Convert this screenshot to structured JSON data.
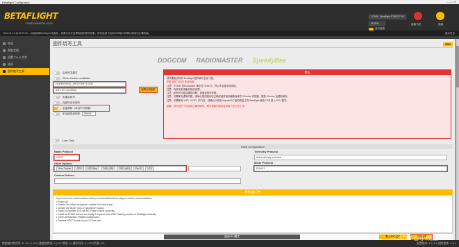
{
  "window": {
    "title": "Betaflight Configurator",
    "controls": "—  ☐  ✕"
  },
  "header": {
    "logo": "BETAFLIGHT",
    "logo_sub": "CONFIGURATOR 10.9.0",
    "port": "COM8 - Betaflight STM32F7X2",
    "baud": "115200",
    "auto_connect": "自动连接",
    "connect_label": "连接飞控",
    "wizard_label": "连接"
  },
  "logbar": {
    "text": "2024-11-15 @13:09:09 -- 欢迎使用Betaflight 地面站，如果无法在此界面找到您的设备，请先连接飞控到USB接口并确认驱动已正确安装。",
    "right_link": "显示日志"
  },
  "sidebar": {
    "items": [
      {
        "label": "欢迎"
      },
      {
        "label": "帮助文档"
      },
      {
        "label": "设置 CLI & 文件"
      },
      {
        "label": "选项"
      },
      {
        "label": "固件烧写工具"
      }
    ]
  },
  "main": {
    "title": "固件烧写工具",
    "wiki": "WIKI",
    "sponsors": [
      "DOGCOM",
      "RADIOMASTER",
      "SpeedyBee"
    ]
  },
  "options": {
    "show_dev": "启用开发模式",
    "show_release_candidates": "Show release candidates",
    "board": "HOBBYWING_XROTORF7CONV",
    "version": "4.5.1 [27-Jul-2024]",
    "load_online": "加载在线固件",
    "no_reboot": "无重启烧写",
    "flash_on_connect": "连接时自动烧写",
    "full_erase": "全盘擦除（永远不可恢复）",
    "manual_baud": "手动选择波特率",
    "manual_baud_value": "256000"
  },
  "warning": {
    "title": "警告",
    "lines": [
      "请不要尝试将非 Betaflight 固件刷写至该飞控。",
      "不要 拔掉飞控或 关闭电脑！",
      "注意：STM32 的bootloader 储存在 ROM 中，所以不会被变砖风险。",
      "注意：在刷写前请备份您的设置。",
      "注意：刷写时可能会遇到问题，请阅读相关说明。",
      "注意：如果刷写遇到问题，请确认您的驱动已正确安装并使用最新版本的 Chrome 浏览器，更新 Chrome 后重新刷写。",
      "注意：如需刷写 USB（VCP）的飞控，请确认已安装 ImpulseRC 驱动修复工具 Betaflight 使用 USB 进入 DFU 模式。",
      "重要：请为您的飞控选择正确的固件。刷写错误的固件会导致飞控无法工作。"
    ]
  },
  "build": {
    "core_only": "Core Only",
    "header": "Build Configuration",
    "radio_label": "Radio Protocol",
    "radio_value": "CRSF",
    "telemetry_label": "Telemetry Protocol",
    "telemetry_value": "Automatically Included",
    "other_label": "Other Options",
    "other_chips": [
      "Acro Trainer",
      "GPS",
      "LED Strip",
      "OSD (SD)",
      "OSD (HD)",
      "Pin IO",
      "VTX"
    ],
    "motor_label": "Motor Protocol",
    "motor_value": "DSHOT",
    "custom_label": "Custom Defines"
  },
  "recovery": {
    "header": "如何恢复飞控",
    "lines": [
      "If you have lost communication with your board follow these steps to restore communication:",
      "• Power off",
      "• Enable 'No reboot sequence', enable 'Full chip erase'.",
      "• Jumper the BOOT pins or hold BOOT button.",
      "• Power on (activity LED will NOT flash if done correctly).",
      "• Install all STM32 drivers and Zadig if required (see USB Flashing section of Betaflight manual).",
      "• Close configurator, Restart Configurator.",
      "• Release BOOT button if your FC has one."
    ]
  },
  "bottom": {
    "exit_dfu": "退出DFU模式",
    "flash_local": "载入本地固件",
    "flash_firmware": "烧写固件"
  },
  "statusbar": {
    "left": "数据端口利用率: D: 0% U: 0% | 数据包错误: 0 | I2C 错误: 0 | 循环时间: 0 | CPU负载: 0%",
    "right": "配置版本: 10.10.0  固件版本: 4.5.1"
  },
  "watermark": "CSDN @小咸鱼"
}
